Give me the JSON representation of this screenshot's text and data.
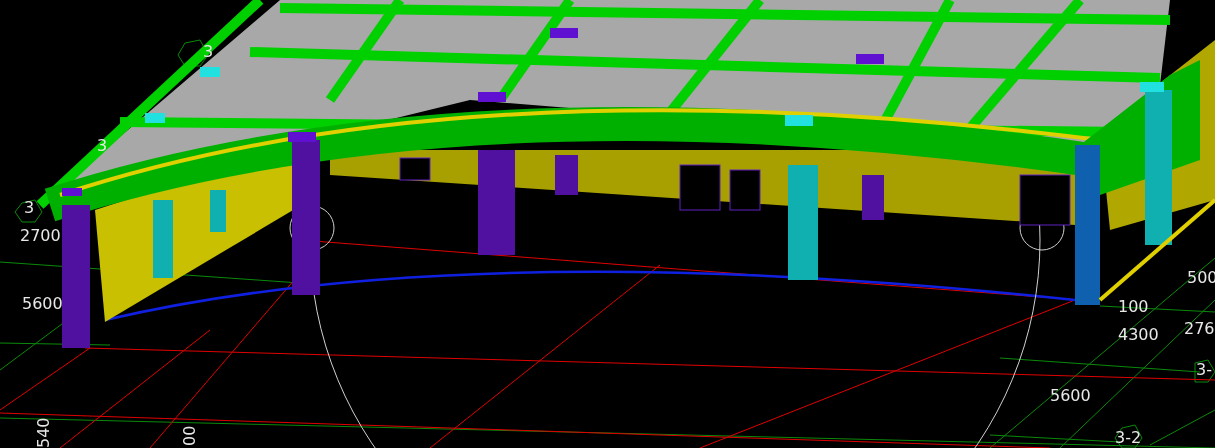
{
  "viewport": {
    "labels": [
      {
        "kind": "axis",
        "text": "3"
      },
      {
        "kind": "axis",
        "text": "3"
      },
      {
        "kind": "axis",
        "text": "3"
      },
      {
        "kind": "dimension",
        "text": "2700"
      },
      {
        "kind": "dimension",
        "text": "5600"
      },
      {
        "kind": "vertical",
        "text": "540"
      },
      {
        "kind": "vertical",
        "text": "00"
      },
      {
        "kind": "dimension",
        "text": "500"
      },
      {
        "kind": "dimension",
        "text": "100"
      },
      {
        "kind": "dimension",
        "text": "276"
      },
      {
        "kind": "dimension",
        "text": "4300"
      },
      {
        "kind": "axis",
        "text": "3-"
      },
      {
        "kind": "dimension",
        "text": "5600"
      },
      {
        "kind": "axis",
        "text": "3-2"
      }
    ]
  }
}
